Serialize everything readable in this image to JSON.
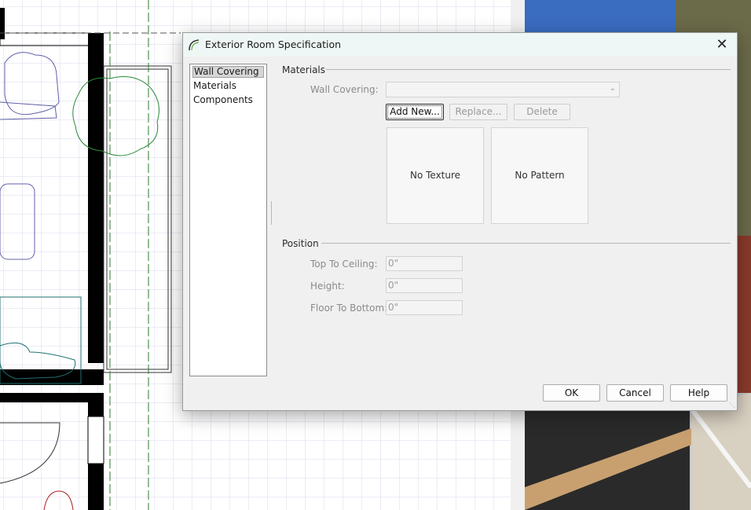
{
  "dialog": {
    "title": "Exterior Room Specification",
    "close_glyph": "✕"
  },
  "nav": {
    "items": [
      {
        "label": "Wall Covering",
        "selected": true
      },
      {
        "label": "Materials",
        "selected": false
      },
      {
        "label": "Components",
        "selected": false
      }
    ]
  },
  "materials": {
    "group_label": "Materials",
    "wall_covering_label": "Wall Covering:",
    "wall_covering_value": "",
    "add_new": "Add New...",
    "replace": "Replace...",
    "delete": "Delete",
    "texture_preview": "No Texture",
    "pattern_preview": "No Pattern"
  },
  "position": {
    "group_label": "Position",
    "top_to_ceiling_label": "Top To Ceiling:",
    "top_to_ceiling_value": "0\"",
    "height_label": "Height:",
    "height_value": "0\"",
    "floor_to_bottom_label": "Floor To Bottom:",
    "floor_to_bottom_value": "0\""
  },
  "footer": {
    "ok": "OK",
    "cancel": "Cancel",
    "help": "Help"
  },
  "colors": {
    "titlebar": "#eef7f5",
    "dialog_bg": "#f0f0f0",
    "plan_grid": "#d5d5ea",
    "plan_wall": "#000000"
  }
}
